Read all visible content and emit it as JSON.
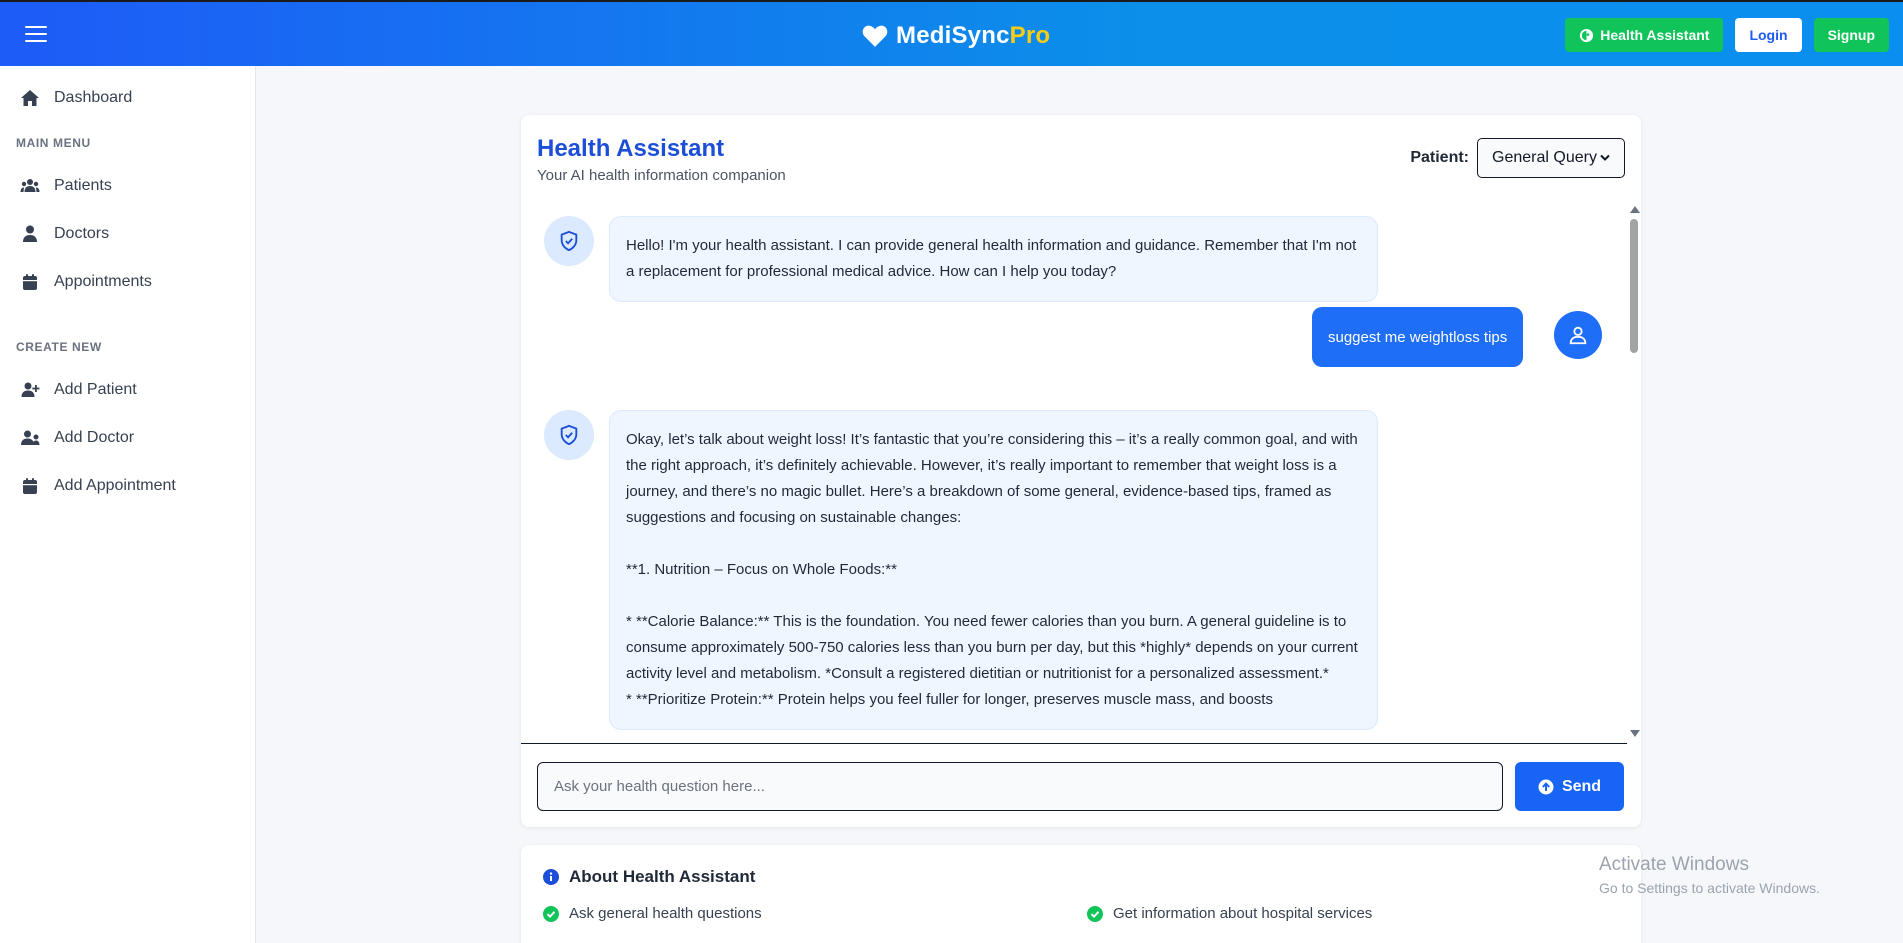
{
  "header": {
    "brand_main": "MediSync",
    "brand_accent": "Pro",
    "health_assistant_label": "Health Assistant",
    "login_label": "Login",
    "signup_label": "Signup"
  },
  "sidebar": {
    "dashboard": "Dashboard",
    "main_menu_heading": "MAIN MENU",
    "main_menu": [
      "Patients",
      "Doctors",
      "Appointments"
    ],
    "create_new_heading": "CREATE NEW",
    "create_new": [
      "Add Patient",
      "Add Doctor",
      "Add Appointment"
    ]
  },
  "assistant": {
    "title": "Health Assistant",
    "subtitle": "Your AI health information companion",
    "patient_label": "Patient:",
    "patient_selected": "General Query"
  },
  "chat": {
    "messages": [
      {
        "role": "bot",
        "text": "Hello! I'm your health assistant. I can provide general health information and guidance. Remember that I'm not a replacement for professional medical advice. How can I help you today?"
      },
      {
        "role": "user",
        "text": "suggest me weightloss tips"
      },
      {
        "role": "bot",
        "text": "Okay, let’s talk about weight loss! It’s fantastic that you’re considering this – it’s a really common goal, and with the right approach, it’s definitely achievable. However, it’s really important to remember that weight loss is a journey, and there’s no magic bullet. Here’s a breakdown of some general, evidence-based tips, framed as suggestions and focusing on sustainable changes:\n\n**1. Nutrition – Focus on Whole Foods:**\n\n* **Calorie Balance:** This is the foundation. You need fewer calories than you burn. A general guideline is to consume approximately 500-750 calories less than you burn per day, but this *highly* depends on your current activity level and metabolism. *Consult a registered dietitian or nutritionist for a personalized assessment.*\n* **Prioritize Protein:** Protein helps you feel fuller for longer, preserves muscle mass, and boosts"
      }
    ],
    "input_placeholder": "Ask your health question here...",
    "send_label": "Send"
  },
  "about": {
    "title": "About Health Assistant",
    "items": [
      "Ask general health questions",
      "Get information about hospital services"
    ]
  },
  "watermark": {
    "line1": "Activate Windows",
    "line2": "Go to Settings to activate Windows."
  },
  "colors": {
    "primary": "#1d4ed8",
    "success": "#10c459",
    "accent": "#facc15"
  }
}
